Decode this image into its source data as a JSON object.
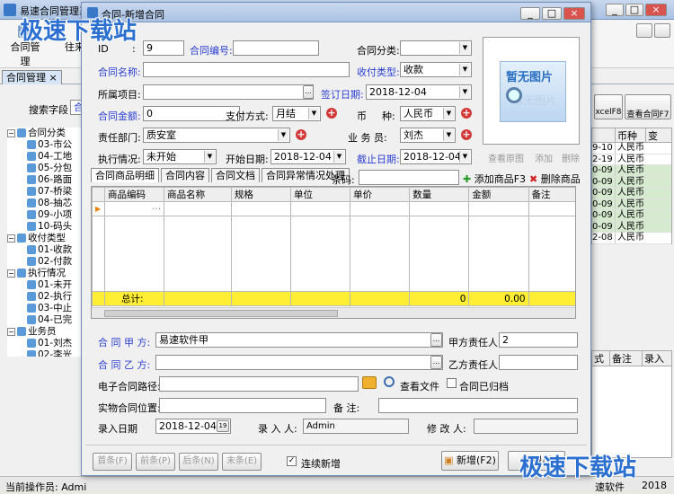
{
  "back_window": {
    "title": "易速合同管理系",
    "toolbar": {
      "contract_mgmt": "合同管理",
      "other": "往来"
    },
    "tab": "合同管理",
    "search_label": "搜索字段",
    "search_value": "合同",
    "tree": [
      {
        "label": "合同分类",
        "children": [
          "03-市公",
          "04-工地",
          "05-分包",
          "06-路面",
          "07-桥梁",
          "08-抽芯",
          "09-小项",
          "10-码头"
        ]
      },
      {
        "label": "收付类型",
        "children": [
          "01-收款",
          "02-付款"
        ]
      },
      {
        "label": "执行情况",
        "children": [
          "01-未开",
          "02-执行",
          "03-中止",
          "04-已完"
        ]
      },
      {
        "label": "业务员",
        "children": [
          "01-刘杰",
          "02-李光"
        ]
      }
    ],
    "right_buttons": {
      "excel": "xcelF8",
      "view": "查看合同F7"
    },
    "right_cols": [
      "币种",
      "变"
    ],
    "right_rows": [
      {
        "d": "9-10",
        "c": "人民币"
      },
      {
        "d": "2-19",
        "c": "人民币"
      },
      {
        "d": "0-09",
        "c": "人民币"
      },
      {
        "d": "0-09",
        "c": "人民币"
      },
      {
        "d": "0-09",
        "c": "人民币"
      },
      {
        "d": "0-09",
        "c": "人民币"
      },
      {
        "d": "0-09",
        "c": "人民币"
      },
      {
        "d": "0-09",
        "c": "人民币"
      },
      {
        "d": "2-08",
        "c": "人民币"
      }
    ],
    "right_cols2": [
      "式",
      "备注",
      "录入"
    ],
    "status_operator": "当前操作员: Admi",
    "status_right": "速软件",
    "status_year": "2018"
  },
  "dialog": {
    "title": "合同-新增合同",
    "id_label": "ID",
    "id_value": "9",
    "contract_no_label": "合同编号:",
    "contract_no": "",
    "category_label": "合同分类:",
    "category": "",
    "name_label": "合同名称:",
    "name": "",
    "pay_type_label": "收付类型:",
    "pay_type": "收款",
    "project_label": "所属项目:",
    "project": "",
    "sign_date_label": "签订日期:",
    "sign_date": "2018-12-04",
    "amount_label": "合同金额:",
    "amount": "0",
    "pay_method_label": "支付方式:",
    "pay_method": "月结",
    "currency_label1": "币",
    "currency_label2": "种:",
    "currency": "人民币",
    "dept_label": "责任部门:",
    "dept": "质安室",
    "salesman_label": "业 务 员:",
    "salesman": "刘杰",
    "exec_label": "执行情况:",
    "exec": "未开始",
    "start_label": "开始日期:",
    "start": "2018-12-04",
    "end_label": "截止日期:",
    "end": "2018-12-04",
    "image": {
      "line1": "暂无图片",
      "line2": "暂无图片"
    },
    "image_links": [
      "查看原图",
      "添加",
      "删除"
    ],
    "tabs": [
      "合同商品明细",
      "合同内容",
      "合同文档",
      "合同异常情况处理"
    ],
    "barcode_label": "条码:",
    "add_goods": "添加商品F3",
    "del_goods": "删除商品",
    "grid_cols": [
      "商品编码",
      "商品名称",
      "规格",
      "单位",
      "单价",
      "数量",
      "金额",
      "备注"
    ],
    "total_label": "总计:",
    "total_qty": "0",
    "total_amount": "0.00",
    "party_a_label": "合 同 甲 方:",
    "party_a": "易速软件甲",
    "party_a_owner_label": "甲方责任人:",
    "party_a_owner": "2",
    "party_b_label": "合 同 乙 方:",
    "party_b": "",
    "party_b_owner_label": "乙方责任人:",
    "party_b_owner": "",
    "epath_label": "电子合同路径:",
    "epath": "",
    "view_file": "查看文件",
    "archived": "合同已归档",
    "location_label": "实物合同位置:",
    "location": "",
    "note_label": "备    注:",
    "note": "",
    "entry_date_label": "录入日期",
    "entry_date": "2018-12-04",
    "entry_user_label": "录 入 人:",
    "entry_user": "Admin",
    "modifier_label": "修 改 人:",
    "modifier": "",
    "nav": [
      "首条(F)",
      "前条(P)",
      "后条(N)",
      "末条(E)"
    ],
    "continuous": "连续新增",
    "new_btn": "新增(F2)",
    "exit_btn": "退出"
  },
  "watermark": "极速下载站"
}
